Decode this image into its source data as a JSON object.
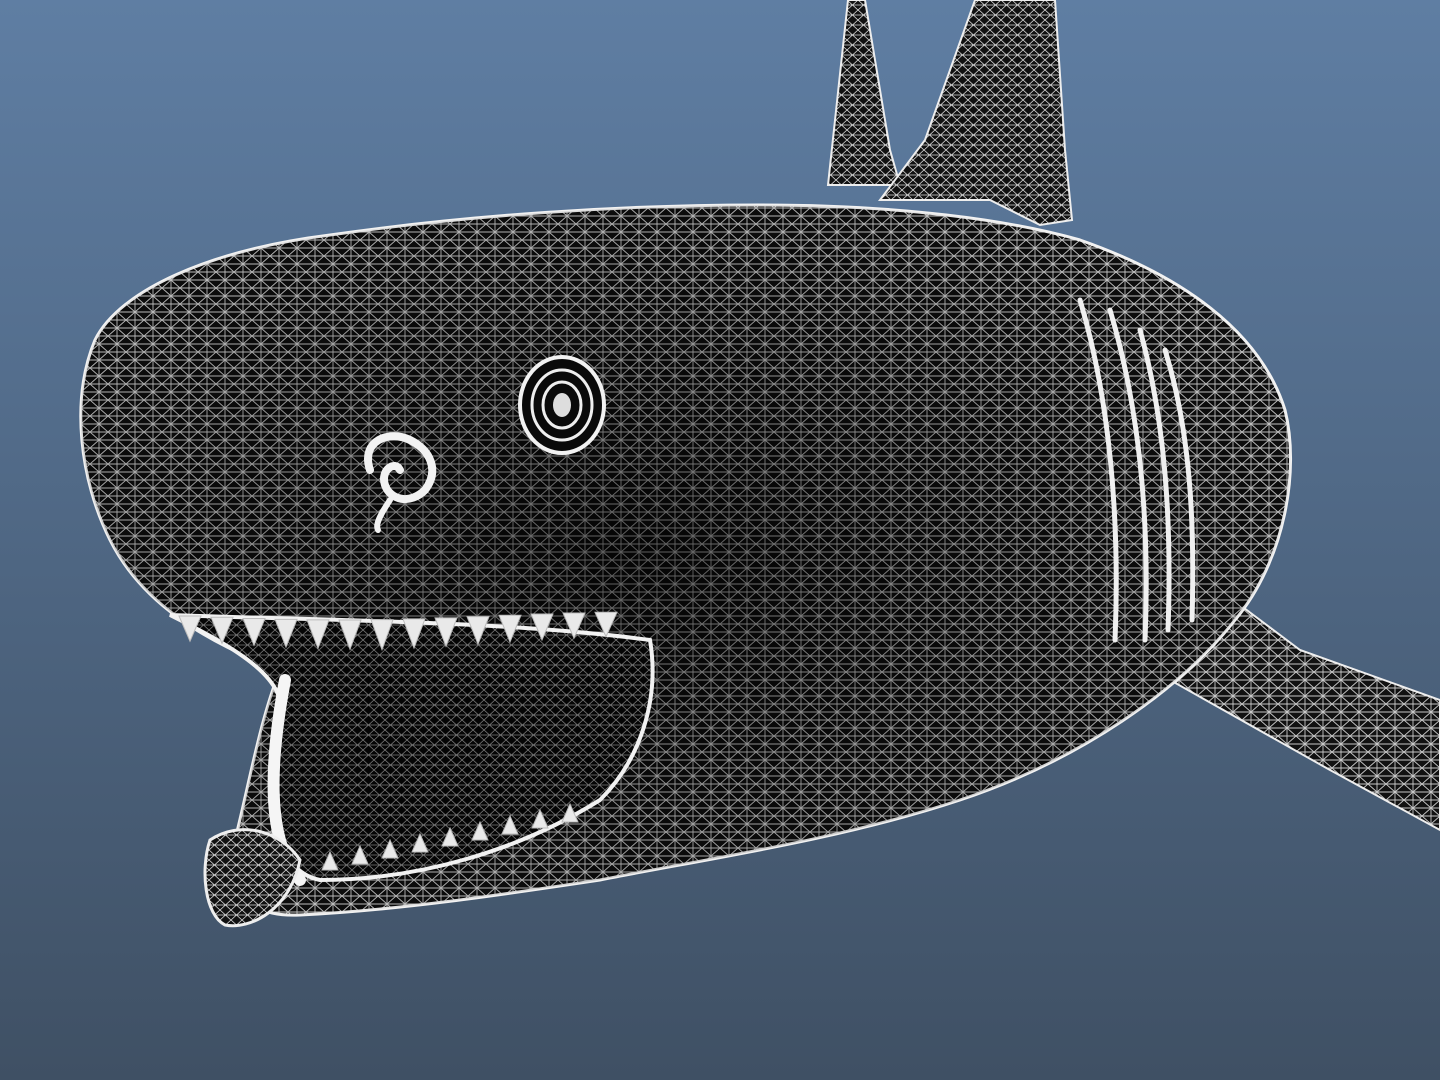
{
  "viewport": {
    "background_top": "#5f7ea3",
    "background_bottom": "#3f5064"
  },
  "model": {
    "subject": "shark",
    "display_mode": "wireframe",
    "wire_color": "#eeeeee",
    "body_color": "#0c0c0c"
  }
}
